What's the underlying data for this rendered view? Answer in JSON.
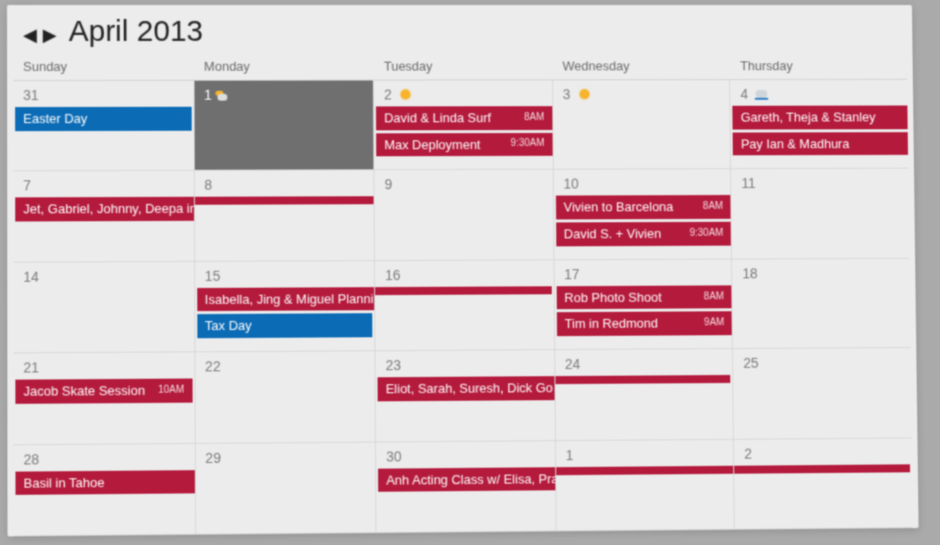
{
  "header": {
    "prev_glyph": "◀",
    "next_glyph": "▶",
    "month_year": "April 2013"
  },
  "day_headers": [
    "Sunday",
    "Monday",
    "Tuesday",
    "Wednesday",
    "Thursday"
  ],
  "weeks": [
    {
      "cells": [
        {
          "date": "31",
          "today": false,
          "icon": null,
          "events": [
            {
              "label": "Easter Day",
              "time": "",
              "color": "blue",
              "span": ""
            }
          ]
        },
        {
          "date": "1",
          "today": true,
          "icon": "suncloud",
          "events": []
        },
        {
          "date": "2",
          "today": false,
          "icon": "sun",
          "events": [
            {
              "label": "David & Linda Surf",
              "time": "8AM",
              "color": "red",
              "span": "r"
            },
            {
              "label": "Max Deployment",
              "time": "9:30AM",
              "color": "red",
              "span": "r"
            }
          ]
        },
        {
          "date": "3",
          "today": false,
          "icon": "sun",
          "events": []
        },
        {
          "date": "4",
          "today": false,
          "icon": "rain",
          "events": [
            {
              "label": "Gareth, Theja & Stanley",
              "time": "",
              "color": "red",
              "span": "r"
            },
            {
              "label": "Pay Ian & Madhura",
              "time": "",
              "color": "red",
              "span": "r"
            }
          ]
        }
      ]
    },
    {
      "cells": [
        {
          "date": "7",
          "today": false,
          "icon": null,
          "events": [
            {
              "label": "Jet, Gabriel, Johnny, Deepa in Santa Cruz",
              "time": "",
              "color": "red",
              "span": "r"
            }
          ]
        },
        {
          "date": "8",
          "today": false,
          "icon": null,
          "events": [
            {
              "label": "",
              "time": "",
              "color": "red",
              "span": "lr"
            }
          ]
        },
        {
          "date": "9",
          "today": false,
          "icon": null,
          "events": []
        },
        {
          "date": "10",
          "today": false,
          "icon": null,
          "events": [
            {
              "label": "Vivien to Barcelona",
              "time": "8AM",
              "color": "red",
              "span": "r"
            },
            {
              "label": "David S. + Vivien",
              "time": "9:30AM",
              "color": "red",
              "span": "r"
            }
          ]
        },
        {
          "date": "11",
          "today": false,
          "icon": null,
          "events": []
        }
      ]
    },
    {
      "cells": [
        {
          "date": "14",
          "today": false,
          "icon": null,
          "events": []
        },
        {
          "date": "15",
          "today": false,
          "icon": null,
          "events": [
            {
              "label": "Isabella, Jing & Miguel Planning Session",
              "time": "",
              "color": "red",
              "span": "r"
            },
            {
              "label": "Tax Day",
              "time": "",
              "color": "blue",
              "span": ""
            }
          ]
        },
        {
          "date": "16",
          "today": false,
          "icon": null,
          "events": [
            {
              "label": "",
              "time": "",
              "color": "red",
              "span": "l"
            }
          ]
        },
        {
          "date": "17",
          "today": false,
          "icon": null,
          "events": [
            {
              "label": "Rob Photo Shoot",
              "time": "8AM",
              "color": "red",
              "span": "r"
            },
            {
              "label": "Tim in Redmond",
              "time": "9AM",
              "color": "red",
              "span": "r"
            }
          ]
        },
        {
          "date": "18",
          "today": false,
          "icon": null,
          "events": []
        }
      ]
    },
    {
      "cells": [
        {
          "date": "21",
          "today": false,
          "icon": null,
          "events": [
            {
              "label": "Jacob Skate Session",
              "time": "10AM",
              "color": "red",
              "span": ""
            }
          ]
        },
        {
          "date": "22",
          "today": false,
          "icon": null,
          "events": []
        },
        {
          "date": "23",
          "today": false,
          "icon": null,
          "events": [
            {
              "label": "Eliot, Sarah, Suresh, Dick Go Sky Diving",
              "time": "",
              "color": "red",
              "span": "r"
            }
          ]
        },
        {
          "date": "24",
          "today": false,
          "icon": null,
          "events": [
            {
              "label": "",
              "time": "",
              "color": "red",
              "span": "l"
            }
          ]
        },
        {
          "date": "25",
          "today": false,
          "icon": null,
          "events": []
        }
      ]
    },
    {
      "cells": [
        {
          "date": "28",
          "today": false,
          "icon": null,
          "events": [
            {
              "label": "Basil in Tahoe",
              "time": "",
              "color": "red",
              "span": "r"
            }
          ]
        },
        {
          "date": "29",
          "today": false,
          "icon": null,
          "events": []
        },
        {
          "date": "30",
          "today": false,
          "icon": null,
          "events": [
            {
              "label": "Anh Acting Class w/ Elisa, Prashant, Justin & Prabin",
              "time": "",
              "color": "red",
              "span": "r"
            }
          ]
        },
        {
          "date": "1",
          "today": false,
          "icon": null,
          "events": [
            {
              "label": "",
              "time": "",
              "color": "red",
              "span": "lr"
            }
          ]
        },
        {
          "date": "2",
          "today": false,
          "icon": null,
          "events": [
            {
              "label": "",
              "time": "",
              "color": "red",
              "span": "l"
            }
          ]
        }
      ]
    }
  ]
}
